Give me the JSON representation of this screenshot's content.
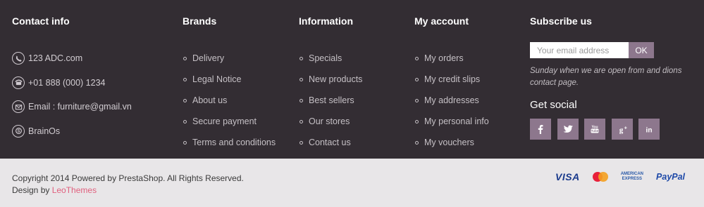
{
  "contact": {
    "title": "Contact info",
    "items": [
      {
        "icon": "phone-circle-icon",
        "text": "123 ADC.com"
      },
      {
        "icon": "telephone-icon",
        "text": "+01 888 (000) 1234"
      },
      {
        "icon": "email-icon",
        "text": "Email : furniture@gmail.vn"
      },
      {
        "icon": "skype-icon",
        "text": "BrainOs"
      }
    ]
  },
  "brands": {
    "title": "Brands",
    "items": [
      "Delivery",
      "Legal Notice",
      "About us",
      "Secure payment",
      "Terms and conditions"
    ]
  },
  "information": {
    "title": "Information",
    "items": [
      "Specials",
      "New products",
      "Best sellers",
      "Our stores",
      "Contact us"
    ]
  },
  "account": {
    "title": "My account",
    "items": [
      "My orders",
      "My credit slips",
      "My addresses",
      "My personal info",
      "My vouchers"
    ]
  },
  "subscribe": {
    "title": "Subscribe us",
    "placeholder": "Your email address",
    "button_label": "OK",
    "note": "Sunday when we are open from and dions contact page.",
    "social_title": "Get social",
    "social": [
      "facebook-icon",
      "twitter-icon",
      "youtube-icon",
      "google-plus-icon",
      "linkedin-icon"
    ]
  },
  "bottom": {
    "copyright": "Copyright 2014 Powered by PrestaShop. All Rights Reserved.",
    "design_prefix": "Design by ",
    "design_link": "LeoThemes",
    "payments": {
      "visa": "VISA",
      "amex_line1": "AMERICAN",
      "amex_line2": "EXPRESS",
      "paypal": "PayPal"
    }
  },
  "colors": {
    "footer_bg": "#332d33",
    "bottom_bg": "#e8e6e8",
    "accent": "#8d778d",
    "link_accent": "#e0607e"
  }
}
